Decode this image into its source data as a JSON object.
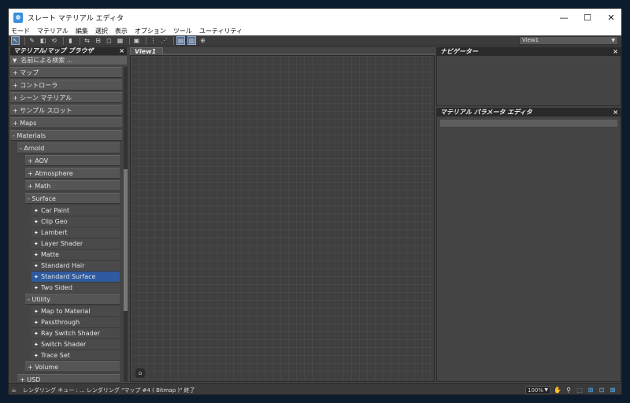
{
  "window": {
    "title": "スレート マテリアル エディタ",
    "controls": {
      "minimize": "—",
      "maximize": "☐",
      "close": "✕"
    }
  },
  "menu": [
    "モード",
    "マテリアル",
    "編集",
    "選択",
    "表示",
    "オプション",
    "ツール",
    "ユーティリティ"
  ],
  "toolbar": {
    "view_select": "View1"
  },
  "browser": {
    "title": "マテリアル/マップ ブラウザ",
    "search_placeholder": "名前による検索 ...",
    "rows": [
      {
        "label": "+ マップ",
        "indent": 0,
        "kind": "cat"
      },
      {
        "label": "+ コントローラ",
        "indent": 0,
        "kind": "cat"
      },
      {
        "label": "+ シーン マテリアル",
        "indent": 0,
        "kind": "cat"
      },
      {
        "label": "+ サンプル スロット",
        "indent": 0,
        "kind": "cat"
      },
      {
        "label": "+ Maps",
        "indent": 0,
        "kind": "cat"
      },
      {
        "label": "- Materials",
        "indent": 0,
        "kind": "cat"
      },
      {
        "label": "- Arnold",
        "indent": 1,
        "kind": "cat"
      },
      {
        "label": "+ AOV",
        "indent": 2,
        "kind": "cat"
      },
      {
        "label": "+ Atmosphere",
        "indent": 2,
        "kind": "cat"
      },
      {
        "label": "+ Math",
        "indent": 2,
        "kind": "cat"
      },
      {
        "label": "- Surface",
        "indent": 2,
        "kind": "cat"
      },
      {
        "label": "Car Paint",
        "indent": 3,
        "kind": "leaf"
      },
      {
        "label": "Clip Geo",
        "indent": 3,
        "kind": "leaf"
      },
      {
        "label": "Lambert",
        "indent": 3,
        "kind": "leaf"
      },
      {
        "label": "Layer Shader",
        "indent": 3,
        "kind": "leaf"
      },
      {
        "label": "Matte",
        "indent": 3,
        "kind": "leaf"
      },
      {
        "label": "Standard Hair",
        "indent": 3,
        "kind": "leaf"
      },
      {
        "label": "Standard Surface",
        "indent": 3,
        "kind": "leaf",
        "selected": true
      },
      {
        "label": "Two Sided",
        "indent": 3,
        "kind": "leaf"
      },
      {
        "label": "- Utility",
        "indent": 2,
        "kind": "cat"
      },
      {
        "label": "Map to Material",
        "indent": 3,
        "kind": "leaf"
      },
      {
        "label": "Passthrough",
        "indent": 3,
        "kind": "leaf"
      },
      {
        "label": "Ray Switch Shader",
        "indent": 3,
        "kind": "leaf"
      },
      {
        "label": "Switch Shader",
        "indent": 3,
        "kind": "leaf"
      },
      {
        "label": "Trace Set",
        "indent": 3,
        "kind": "leaf"
      },
      {
        "label": "+ Volume",
        "indent": 2,
        "kind": "cat"
      },
      {
        "label": "+ USD",
        "indent": 1,
        "kind": "cat"
      }
    ]
  },
  "view": {
    "tab_label": "View1"
  },
  "navigator": {
    "title": "ナビゲーター"
  },
  "param_editor": {
    "title": "マテリアル パラメータ エディタ"
  },
  "status": {
    "text": "レンダリング キュー : ... レンダリング \"マップ #4 ( Bitmap )\" 終了",
    "zoom": "100%"
  },
  "colors": {
    "selection": "#2e5aa0",
    "background": "#444444",
    "active_tool": "#5a6f8f"
  }
}
